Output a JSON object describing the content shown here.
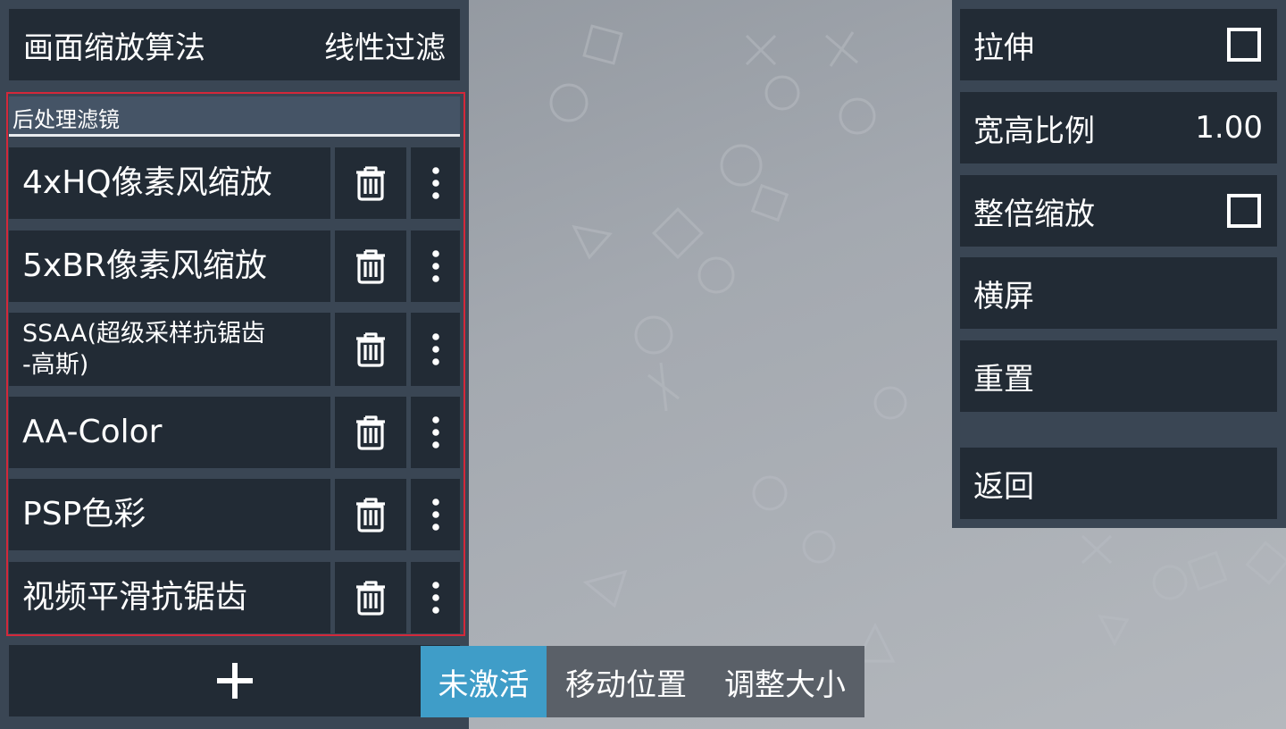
{
  "left_panel": {
    "scaling": {
      "label": "画面缩放算法",
      "value": "线性过滤"
    },
    "postprocess": {
      "section_title": "后处理滤镜",
      "filters": [
        {
          "name": "4xHQ像素风缩放"
        },
        {
          "name": "5xBR像素风缩放"
        },
        {
          "name": "SSAA(超级采样抗锯齿\n-高斯)"
        },
        {
          "name": "AA-Color"
        },
        {
          "name": "PSP色彩"
        },
        {
          "name": "视频平滑抗锯齿"
        }
      ]
    },
    "add_label": "+"
  },
  "mode_tabs": {
    "inactive": "未激活",
    "move": "移动位置",
    "resize": "调整大小"
  },
  "right_panel": {
    "stretch": {
      "label": "拉伸",
      "checked": false
    },
    "aspect_ratio": {
      "label": "宽高比例",
      "value": "1.00"
    },
    "integer_scale": {
      "label": "整倍缩放",
      "checked": false
    },
    "rotation_label": "横屏",
    "reset_label": "重置",
    "back_label": "返回"
  },
  "icons": {
    "delete": "trash-icon",
    "more": "more-vertical-icon",
    "add": "plus-icon"
  },
  "colors": {
    "panel_bg": "#3a4654",
    "tile_bg": "#222b35",
    "section_header_bg": "#455466",
    "active_tab": "#3f9dc8",
    "inactive_tab": "#5a6068",
    "selection_outline": "#d4283a"
  }
}
